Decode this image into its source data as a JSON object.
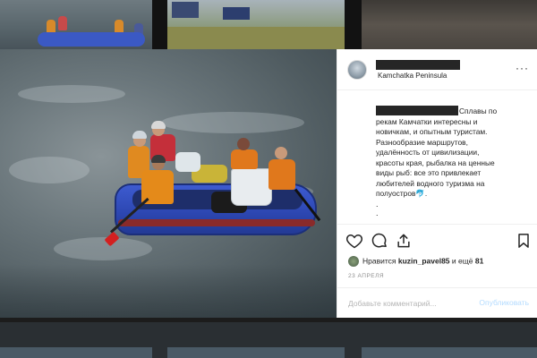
{
  "post": {
    "location": "Kamchatka Peninsula",
    "caption_lines": [
      "Сплавы по",
      "рекам Камчатки интересны и",
      "новичкам, и опытным туристам.",
      "Разнообразие маршрутов,",
      "удалённость от цивилизации,",
      "красоты края, рыбалка на ценные",
      "виды рыб: все это привлекает",
      "любителей водного туризма на",
      "полуостров🐬."
    ],
    "dots": [
      ".",
      "."
    ],
    "likes_prefix": "Нравится",
    "likes_user": "kuzin_pavel85",
    "likes_suffix": "и ещё",
    "likes_count": "81",
    "date": "23 АПРЕЛЯ",
    "comment_placeholder": "Добавьте комментарий...",
    "publish_label": "Опубликовать",
    "more_label": "···"
  },
  "icons": {
    "like": "heart-icon",
    "comment": "comment-icon",
    "share": "share-icon",
    "save": "bookmark-icon",
    "more": "more-options-icon"
  },
  "colors": {
    "text": "#262626",
    "muted": "#8e8e8e",
    "publish_disabled": "#b3dbff"
  }
}
